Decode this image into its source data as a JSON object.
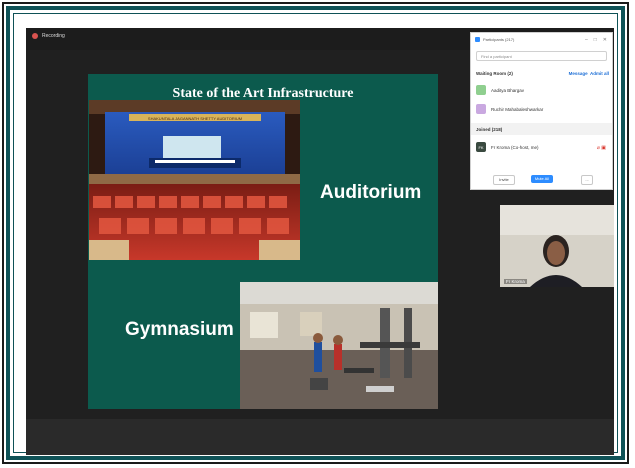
{
  "recording": {
    "label": "Recording"
  },
  "slide": {
    "title": "State of the Art Infrastructure",
    "auditorium_label": "Auditorium",
    "gymnasium_label": "Gymnasium",
    "auditorium_banner": "SHAKUNTALA JAGANNATH SHETTY AUDITORIUM"
  },
  "participants": {
    "title": "Participants (217)",
    "search_placeholder": "Find a participant",
    "waiting_room": {
      "label": "Waiting Room (2)",
      "message": "Message",
      "admit_all": "Admit all"
    },
    "waiting": [
      {
        "name": "Aaditya Bhargav",
        "color": "#8fcf8f"
      },
      {
        "name": "Ruchir Mahabaleshwarkar",
        "color": "#c9a8e0"
      }
    ],
    "joined": {
      "label": "Joined (218)"
    },
    "host": {
      "name": "Fr Kroma (Co-host, me)",
      "initials": "FK",
      "color": "#3a4a40"
    },
    "footer": {
      "invite": "Invite",
      "mute_all": "Mute All",
      "more": "..."
    }
  },
  "video": {
    "name": "Fr Kroma"
  },
  "colors": {
    "teal": "#0f5257",
    "slide_green": "#0c5a4d",
    "zoom_blue": "#2d8cff"
  },
  "icons": [
    "recording-dot-icon",
    "zoom-logo-icon",
    "mic-muted-icon",
    "video-off-icon"
  ]
}
